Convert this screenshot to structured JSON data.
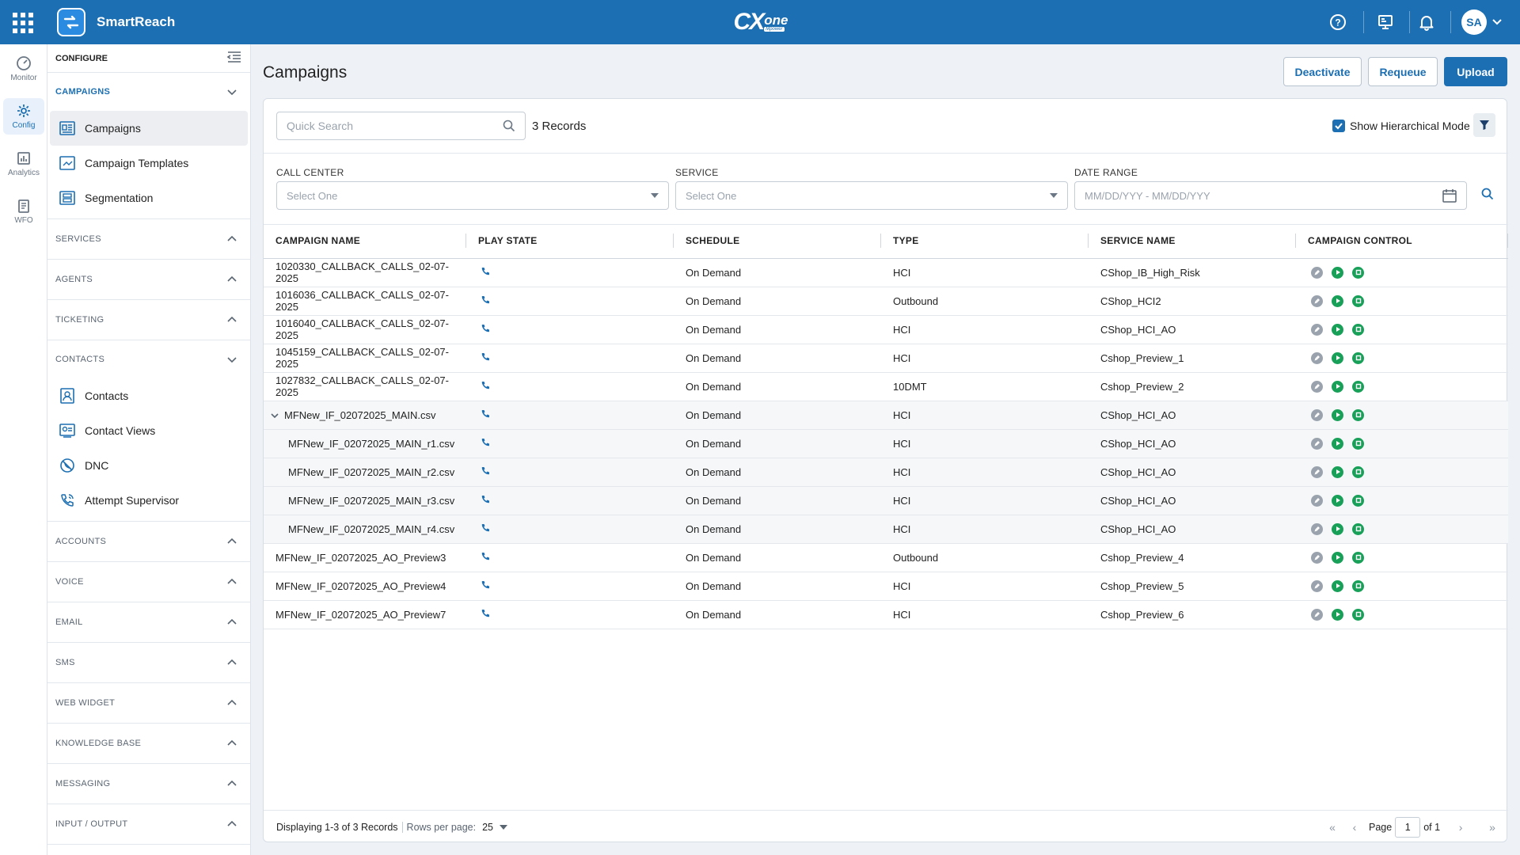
{
  "app": {
    "name": "SmartReach",
    "brand_main": "CX",
    "brand_one": "one",
    "brand_sub": "Mpower",
    "user_initials": "SA"
  },
  "rail": [
    {
      "label": "Monitor",
      "icon": "gauge-icon"
    },
    {
      "label": "Config",
      "icon": "gear-icon",
      "active": true
    },
    {
      "label": "Analytics",
      "icon": "chart-icon"
    },
    {
      "label": "WFO",
      "icon": "clipboard-icon"
    }
  ],
  "sidebar": {
    "header": "CONFIGURE",
    "campaigns_section": "CAMPAIGNS",
    "campaigns_items": [
      "Campaigns",
      "Campaign Templates",
      "Segmentation"
    ],
    "services": "SERVICES",
    "agents": "AGENTS",
    "ticketing": "TICKETING",
    "contacts_section": "CONTACTS",
    "contacts_items": [
      "Contacts",
      "Contact Views",
      "DNC",
      "Attempt Supervisor"
    ],
    "accounts": "ACCOUNTS",
    "voice": "VOICE",
    "email": "EMAIL",
    "sms": "SMS",
    "web_widget": "WEB WIDGET",
    "knowledge_base": "KNOWLEDGE BASE",
    "messaging": "MESSAGING",
    "input_output": "INPUT / OUTPUT"
  },
  "page": {
    "title": "Campaigns",
    "deactivate": "Deactivate",
    "requeue": "Requeue",
    "upload": "Upload"
  },
  "toolbar": {
    "search_placeholder": "Quick Search",
    "records": "3 Records",
    "hierarchical_label": "Show Hierarchical Mode"
  },
  "filters": {
    "call_center_label": "CALL CENTER",
    "call_center_value": "Select One",
    "service_label": "SERVICE",
    "service_value": "Select One",
    "date_label": "DATE RANGE",
    "date_value": "MM/DD/YYY - MM/DD/YYY"
  },
  "table": {
    "headers": [
      "CAMPAIGN NAME",
      "PLAY STATE",
      "SCHEDULE",
      "TYPE",
      "SERVICE NAME",
      "CAMPAIGN CONTROL"
    ],
    "rows": [
      {
        "name": "1020330_CALLBACK_CALLS_02-07-2025",
        "schedule": "On Demand",
        "type": "HCI",
        "service": "CShop_IB_High_Risk"
      },
      {
        "name": "1016036_CALLBACK_CALLS_02-07-2025",
        "schedule": "On Demand",
        "type": "Outbound",
        "service": "CShop_HCI2"
      },
      {
        "name": "1016040_CALLBACK_CALLS_02-07-2025",
        "schedule": "On Demand",
        "type": "HCI",
        "service": "CShop_HCI_AO"
      },
      {
        "name": "1045159_CALLBACK_CALLS_02-07-2025",
        "schedule": "On Demand",
        "type": "HCI",
        "service": "Cshop_Preview_1"
      },
      {
        "name": "1027832_CALLBACK_CALLS_02-07-2025",
        "schedule": "On Demand",
        "type": "10DMT",
        "service": "Cshop_Preview_2"
      },
      {
        "name": "MFNew_IF_02072025_MAIN.csv",
        "schedule": "On Demand",
        "type": "HCI",
        "service": "CShop_HCI_AO"
      },
      {
        "name": "MFNew_IF_02072025_MAIN_r1.csv",
        "schedule": "On Demand",
        "type": "HCI",
        "service": "CShop_HCI_AO"
      },
      {
        "name": "MFNew_IF_02072025_MAIN_r2.csv",
        "schedule": "On Demand",
        "type": "HCI",
        "service": "CShop_HCI_AO"
      },
      {
        "name": "MFNew_IF_02072025_MAIN_r3.csv",
        "schedule": "On Demand",
        "type": "HCI",
        "service": "CShop_HCI_AO"
      },
      {
        "name": "MFNew_IF_02072025_MAIN_r4.csv",
        "schedule": "On Demand",
        "type": "HCI",
        "service": "CShop_HCI_AO"
      },
      {
        "name": "MFNew_IF_02072025_AO_Preview3",
        "schedule": "On Demand",
        "type": "Outbound",
        "service": "Cshop_Preview_4"
      },
      {
        "name": "MFNew_IF_02072025_AO_Preview4",
        "schedule": "On Demand",
        "type": "HCI",
        "service": "Cshop_Preview_5"
      },
      {
        "name": "MFNew_IF_02072025_AO_Preview7",
        "schedule": "On Demand",
        "type": "HCI",
        "service": "Cshop_Preview_6"
      }
    ]
  },
  "footer": {
    "displaying": "Displaying 1-3 of 3 Records",
    "rows_per_page": "Rows per page:",
    "rows_value": "25",
    "page_label": "Page",
    "page_value": "1",
    "of_pages": "of 1"
  },
  "colors": {
    "brand": "#1c6fb2",
    "play": "#18a058",
    "neutral": "#9aa3ad"
  }
}
